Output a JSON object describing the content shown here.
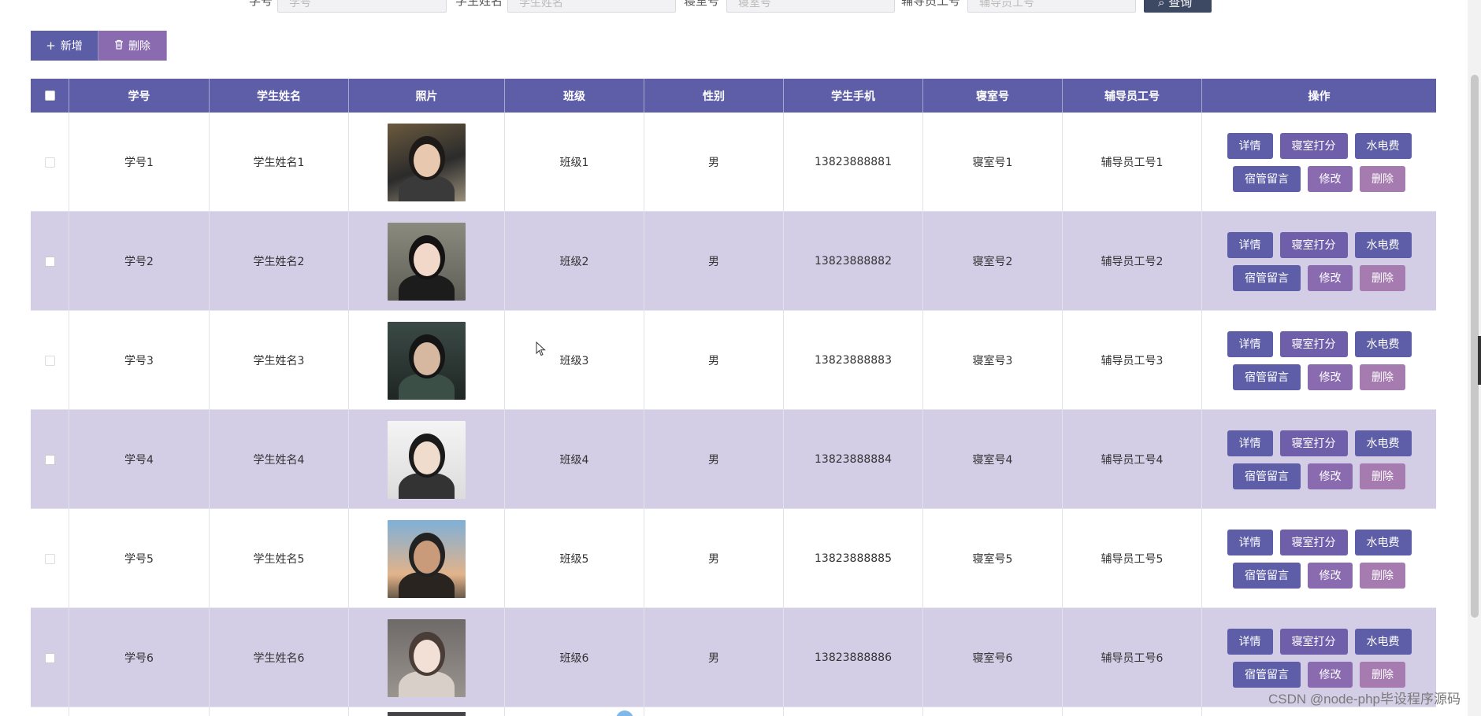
{
  "search": {
    "labels": [
      "学号",
      "学生姓名",
      "寝室号",
      "辅导员工号"
    ],
    "placeholders": [
      "学号",
      "学生姓名",
      "寝室号",
      "辅导员工号"
    ],
    "query_label": "查询"
  },
  "toolbar": {
    "add_label": "新增",
    "delete_label": "删除"
  },
  "table": {
    "headers": [
      "学号",
      "学生姓名",
      "照片",
      "班级",
      "性别",
      "学生手机",
      "寝室号",
      "辅导员工号",
      "操作"
    ],
    "rows": [
      {
        "id": "学号1",
        "name": "学生姓名1",
        "class": "班级1",
        "gender": "男",
        "phone": "13823888881",
        "dorm": "寝室号1",
        "counselor": "辅导员工号1"
      },
      {
        "id": "学号2",
        "name": "学生姓名2",
        "class": "班级2",
        "gender": "男",
        "phone": "13823888882",
        "dorm": "寝室号2",
        "counselor": "辅导员工号2"
      },
      {
        "id": "学号3",
        "name": "学生姓名3",
        "class": "班级3",
        "gender": "男",
        "phone": "13823888883",
        "dorm": "寝室号3",
        "counselor": "辅导员工号3"
      },
      {
        "id": "学号4",
        "name": "学生姓名4",
        "class": "班级4",
        "gender": "男",
        "phone": "13823888884",
        "dorm": "寝室号4",
        "counselor": "辅导员工号4"
      },
      {
        "id": "学号5",
        "name": "学生姓名5",
        "class": "班级5",
        "gender": "男",
        "phone": "13823888885",
        "dorm": "寝室号5",
        "counselor": "辅导员工号5"
      },
      {
        "id": "学号6",
        "name": "学生姓名6",
        "class": "班级6",
        "gender": "男",
        "phone": "13823888886",
        "dorm": "寝室号6",
        "counselor": "辅导员工号6"
      }
    ],
    "row_actions": {
      "detail": "详情",
      "score": "寝室打分",
      "fee": "水电费",
      "message": "宿管留言",
      "edit": "修改",
      "delete": "删除"
    }
  },
  "watermark": "CSDN @node-php毕设程序源码",
  "colors": {
    "header_bg": "#5e5ea8",
    "alt_row_bg": "#d3cde6",
    "add_button": "#5b5ea6",
    "delete_button": "#8a6bb0",
    "query_button": "#3d4863"
  }
}
